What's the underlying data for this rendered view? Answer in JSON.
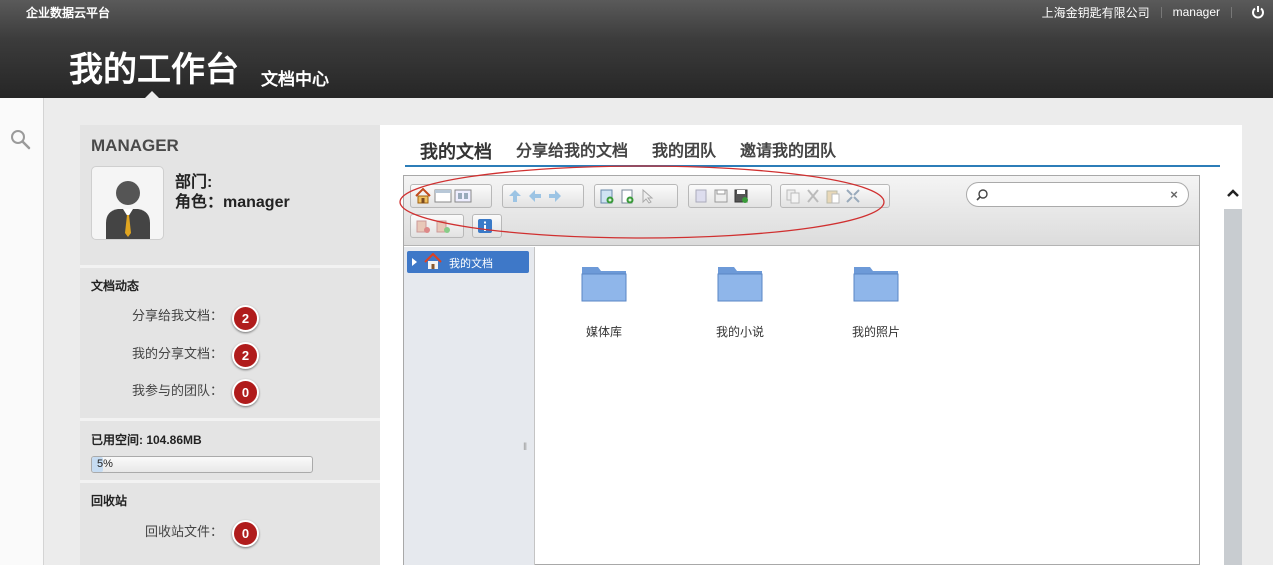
{
  "app": {
    "brand": "企业数据云平台",
    "company": "上海金钥匙有限公司",
    "user": "manager"
  },
  "header": {
    "title": "我的工作台",
    "subtitle": "文档中心"
  },
  "profile": {
    "name": "MANAGER",
    "dept_label": "部门:",
    "role_label": "角色：manager"
  },
  "doc_activity": {
    "title": "文档动态",
    "items": [
      {
        "label": "分享给我文档：",
        "count": "2"
      },
      {
        "label": "我的分享文档：",
        "count": "2"
      },
      {
        "label": "我参与的团队：",
        "count": "0"
      }
    ]
  },
  "storage": {
    "label": "已用空间: 104.86MB",
    "percent_text": "5%",
    "percent": 5
  },
  "recycle": {
    "title": "回收站",
    "label": "回收站文件：",
    "count": "0"
  },
  "tabs": [
    {
      "label": "我的文档",
      "active": true
    },
    {
      "label": "分享给我的文档"
    },
    {
      "label": "我的团队"
    },
    {
      "label": "邀请我的团队"
    }
  ],
  "file_manager": {
    "search": {
      "value": "",
      "placeholder": ""
    },
    "tree": {
      "root_label": "我的文档"
    },
    "folders": [
      {
        "label": "媒体库"
      },
      {
        "label": "我的小说"
      },
      {
        "label": "我的照片"
      }
    ],
    "toolbar_icons": [
      "home-icon",
      "view-list-icon",
      "view-icons-icon",
      "up-icon",
      "back-icon",
      "forward-icon",
      "new-folder-icon",
      "new-file-icon",
      "select-icon",
      "open-icon",
      "save-icon",
      "save-as-icon",
      "copy-icon",
      "cut-icon",
      "paste-icon",
      "expand-icon",
      "delete-icon",
      "rename-icon",
      "info-icon"
    ]
  },
  "colors": {
    "header_bg": "#2f2f2f",
    "accent": "#2c7db8",
    "badge": "#b01c1c",
    "annotation": "#d03030",
    "tree_selected": "#3e78c8"
  }
}
